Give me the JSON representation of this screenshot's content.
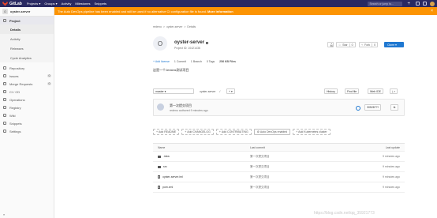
{
  "topbar": {
    "brand": "GitLab",
    "nav": [
      "Projects ▾",
      "Groups ▾",
      "Activity",
      "Milestones",
      "Snippets"
    ],
    "search_placeholder": "Search or jump to..."
  },
  "banner": {
    "text": "The Auto DevOps pipeline has been enabled and will be used if no alternative CI configuration file is found.",
    "link": "More information"
  },
  "sidebar": {
    "project_initial": "O",
    "project_name": "oyster-server",
    "project_item": "Project",
    "sub_items": [
      "Details",
      "Activity",
      "Releases",
      "Cycle Analytics"
    ],
    "items": [
      {
        "label": "Repository",
        "badge": ""
      },
      {
        "label": "Issues",
        "badge": "0"
      },
      {
        "label": "Merge Requests",
        "badge": "0"
      },
      {
        "label": "CI / CD",
        "badge": ""
      },
      {
        "label": "Operations",
        "badge": ""
      },
      {
        "label": "Registry",
        "badge": ""
      },
      {
        "label": "Wiki",
        "badge": ""
      },
      {
        "label": "Snippets",
        "badge": ""
      },
      {
        "label": "Settings",
        "badge": ""
      }
    ],
    "collapse": "«"
  },
  "breadcrumbs": [
    "redeno",
    ">",
    "oyster-server",
    ">",
    "Details"
  ],
  "project": {
    "initial": "O",
    "name": "oyster-server",
    "id_text": "Project ID: 10421436",
    "star_label": "Star",
    "star_count": "0",
    "fork_label": "Fork",
    "fork_count": "0",
    "clone_label": "Clone ▾",
    "stats": [
      "+ Add license",
      "1 Commit",
      "1 Branch",
      "0 Tags",
      "256 KB Files"
    ],
    "description": "这是一个Jenkins测试项目"
  },
  "repo_nav": {
    "branch": "master ▾",
    "path": "oyster-server",
    "path_sep": "/",
    "add_button": "+ ▾",
    "history": "History",
    "find_file": "Find file",
    "web_ide": "Web IDE",
    "download": "⤓ ▾"
  },
  "commit": {
    "title": "第一次提交项目",
    "meta": "redeno authored 9 minutes ago",
    "sha": "3052877f",
    "copy": "⧉"
  },
  "tiles": [
    "Add README",
    "Add CHANGELOG",
    "Add CONTRIBUTING",
    "Auto DevOps enabled",
    "Add Kubernetes cluster"
  ],
  "files": {
    "headers": [
      "Name",
      "Last commit",
      "Last update"
    ],
    "rows": [
      {
        "icon": "folder",
        "name": ".idea",
        "commit": "第一次提交项目",
        "updated": "9 minutes ago"
      },
      {
        "icon": "folder",
        "name": "src",
        "commit": "第一次提交项目",
        "updated": "9 minutes ago"
      },
      {
        "icon": "file",
        "name": "oyster-server.iml",
        "commit": "第一次提交项目",
        "updated": "9 minutes ago"
      },
      {
        "icon": "file",
        "name": "pom.xml",
        "commit": "第一次提交项目",
        "updated": "9 minutes ago"
      }
    ]
  },
  "watermark": "https://blog.csdn.net/qq_35921773"
}
